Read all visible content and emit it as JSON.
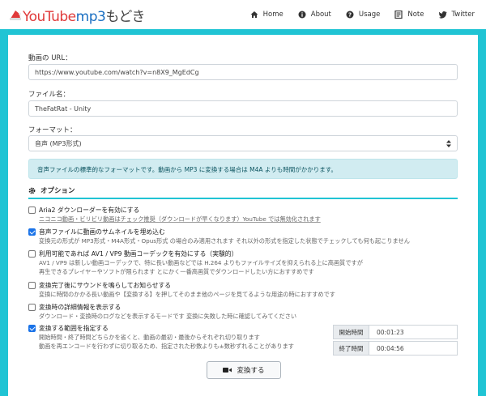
{
  "brand": {
    "part1": "YouTube",
    "part2": "mp3",
    "part3": "もどき"
  },
  "nav": [
    {
      "label": "Home",
      "icon": "home-icon"
    },
    {
      "label": "About",
      "icon": "info-icon"
    },
    {
      "label": "Usage",
      "icon": "question-icon"
    },
    {
      "label": "Note",
      "icon": "note-icon"
    },
    {
      "label": "Twitter",
      "icon": "twitter-icon"
    }
  ],
  "form": {
    "url_label": "動画の URL：",
    "url_value": "https://www.youtube.com/watch?v=n8X9_MgEdCg",
    "filename_label": "ファイル名：",
    "filename_value": "TheFatRat - Unity",
    "format_label": "フォーマット：",
    "format_value": "音声 (MP3形式)",
    "alert": "音声ファイルの標準的なフォーマットです。動画から MP3 に変換する場合は M4A よりも時間がかかります。"
  },
  "options": {
    "header": "オプション",
    "items": [
      {
        "title": "Aria2 ダウンローダーを有効にする",
        "desc": [
          "ニコニコ動画・ビリビリ動画はチェック推奨（ダウンロードが早くなります）YouTube では無効化されます"
        ],
        "checked": false
      },
      {
        "title": "音声ファイルに動画のサムネイルを埋め込む",
        "desc": [
          "変換元の形式が MP3形式・M4A形式・Opus形式 の場合のみ適用されます それ以外の形式を指定した状態でチェックしても何も起こりません"
        ],
        "checked": true
      },
      {
        "title": "利用可能であれば AV1 / VP9 動画コーデックを有効にする（実験的）",
        "desc": [
          "AV1 / VP9 は新しい動画コーデックで、特に長い動画などでは H.264 よりもファイルサイズを抑えられる上に高画質ですが",
          "再生できるプレイヤーやソフトが限られます とにかく一番高画質でダウンロードしたい方におすすめです"
        ],
        "checked": false
      },
      {
        "title": "変換完了後にサウンドを鳴らしてお知らせする",
        "desc": [
          "変換に時間のかかる長い動画や【変換する】を押してそのまま他のページを見てるような用途の時におすすめです"
        ],
        "checked": false
      },
      {
        "title": "変換時の詳細情報を表示する",
        "desc": [
          "ダウンロード・変換時のログなどを表示するモードです 変換に失敗した時に確認してみてください"
        ],
        "checked": false
      },
      {
        "title": "変換する範囲を指定する",
        "desc": [
          "開始時間・終了時間どちらかを省くと、動画の最初・最後からそれぞれ切り取ります",
          "動画を再エンコードを行わずに切り取るため、指定された秒数よりも±数秒ずれることがあります"
        ],
        "checked": true
      }
    ],
    "start_label": "開始時間",
    "start_value": "00:01:23",
    "end_label": "終了時間",
    "end_value": "00:04:56"
  },
  "convert_button": "変換する"
}
